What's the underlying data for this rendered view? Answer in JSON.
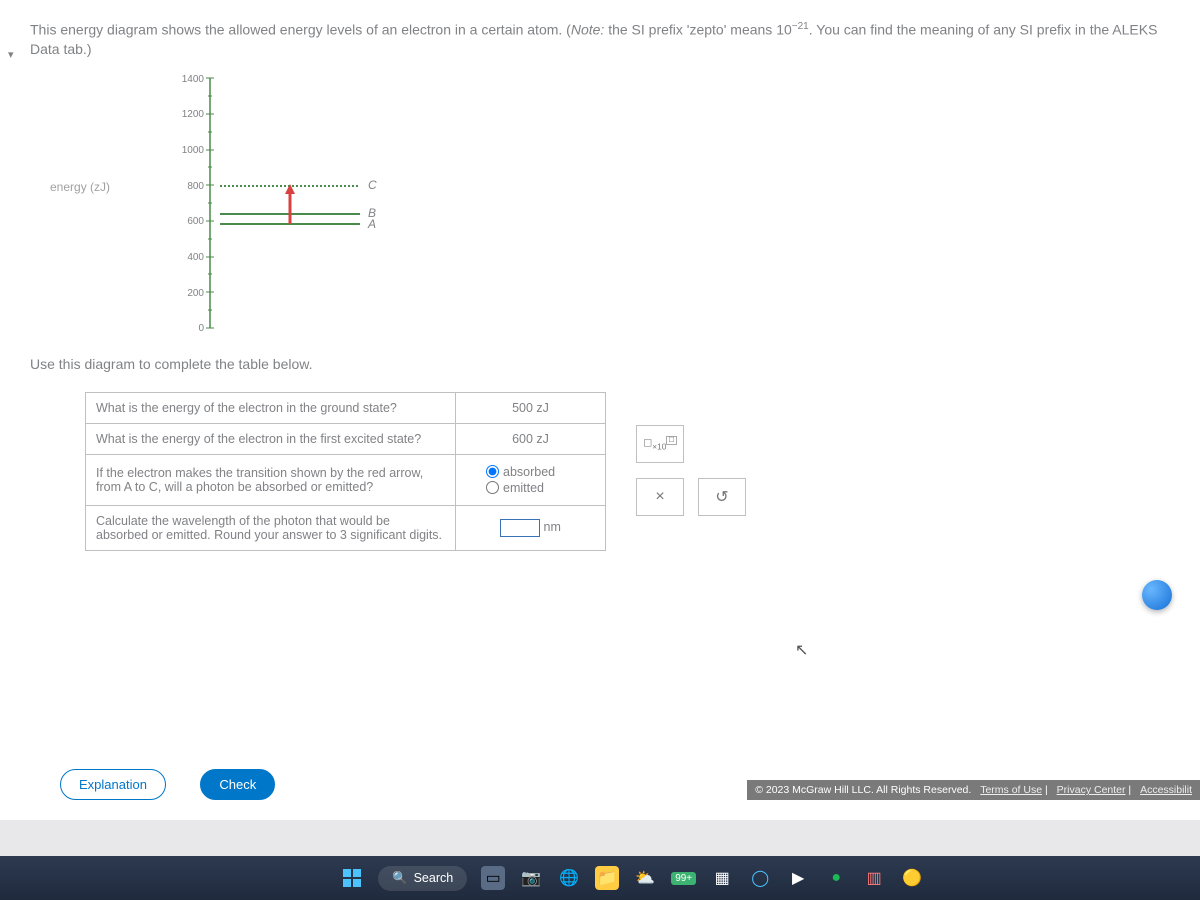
{
  "problem": {
    "intro_a": "This energy diagram shows the allowed energy levels of an electron in a certain atom. (",
    "note_label": "Note:",
    "note_text": " the SI prefix 'zepto' means 10",
    "exp": "−21",
    "intro_b": ". You can find the meaning of any SI prefix in the ALEKS Data tab.)"
  },
  "chart_data": {
    "type": "level-diagram",
    "ylabel": "energy (zJ)",
    "ylim": [
      0,
      1400
    ],
    "ticks": [
      0,
      200,
      400,
      600,
      800,
      1000,
      1200,
      1400
    ],
    "levels": [
      {
        "name": "A",
        "value": 580
      },
      {
        "name": "B",
        "value": 640
      },
      {
        "name": "C",
        "value": 800
      }
    ],
    "arrow": {
      "from": "A",
      "to": "C",
      "color": "red"
    }
  },
  "instruction": "Use this diagram to complete the table below.",
  "table": {
    "rows": [
      {
        "q": "What is the energy of the electron in the ground state?",
        "a_prefix": "500",
        "a_unit": "zJ"
      },
      {
        "q": "What is the energy of the electron in the first excited state?",
        "a_prefix": "600",
        "a_unit": "zJ"
      },
      {
        "q": "If the electron makes the transition shown by the red arrow, from A to C, will a photon be absorbed or emitted?",
        "opt1": "absorbed",
        "opt2": "emitted",
        "selected": "absorbed"
      },
      {
        "q": "Calculate the wavelength of the photon that would be absorbed or emitted. Round your answer to 3 significant digits.",
        "a_unit": "nm"
      }
    ]
  },
  "tools": {
    "sci": "×10",
    "close": "×",
    "undo": "↺"
  },
  "buttons": {
    "explanation": "Explanation",
    "check": "Check"
  },
  "footer": {
    "copyright": "© 2023 McGraw Hill LLC. All Rights Reserved.",
    "links": [
      "Terms of Use",
      "Privacy Center",
      "Accessibilit"
    ]
  },
  "taskbar": {
    "search_placeholder": "Search",
    "badge": "99+"
  }
}
